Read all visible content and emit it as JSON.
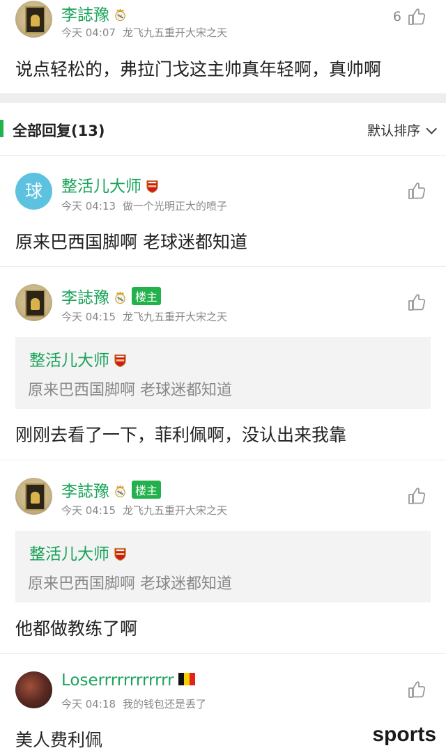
{
  "top_comment": {
    "user": "李誌豫",
    "time": "今天 04:07",
    "signature": "龙飞九五重开大宋之天",
    "likes": "6",
    "text": "说点轻松的，弗拉门戈这主帅真年轻啊，真帅啊"
  },
  "section": {
    "title": "全部回复(13)",
    "sort_label": "默认排序"
  },
  "replies": [
    {
      "user": "整活儿大师",
      "avatar_char": "球",
      "time": "今天 04:13",
      "signature": "做一个光明正大的喷子",
      "text": "原来巴西国脚啊 老球迷都知道"
    },
    {
      "user": "李誌豫",
      "owner_tag": "楼主",
      "time": "今天 04:15",
      "signature": "龙飞九五重开大宋之天",
      "quote_user": "整活儿大师",
      "quote_text": "原来巴西国脚啊 老球迷都知道",
      "text": "刚刚去看了一下，菲利佩啊，没认出来我靠"
    },
    {
      "user": "李誌豫",
      "owner_tag": "楼主",
      "time": "今天 04:15",
      "signature": "龙飞九五重开大宋之天",
      "quote_user": "整活儿大师",
      "quote_text": "原来巴西国脚啊 老球迷都知道",
      "text": "他都做教练了啊"
    },
    {
      "user": "Loserrrrrrrrrrrr",
      "time": "今天 04:18",
      "signature": "我的钱包还是丢了",
      "text": "美人费利佩"
    }
  ],
  "watermark": "sports",
  "colors": {
    "accent": "#1aa35a",
    "tag_bg": "#22b14c",
    "meta": "#888888"
  },
  "icons": [
    "thumbs-up-icon",
    "real-madrid-badge-icon",
    "arsenal-badge-icon",
    "belgium-flag-icon",
    "chevron-down-icon"
  ]
}
